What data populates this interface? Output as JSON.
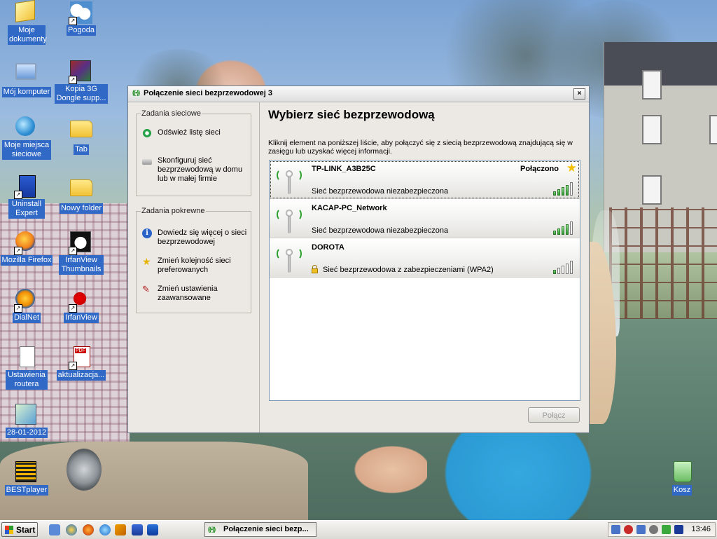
{
  "desktop": {
    "icons": [
      {
        "label": "Moje dokumenty",
        "glyph": "my-documents-icon"
      },
      {
        "label": "Pogoda",
        "glyph": "weather-icon"
      },
      {
        "label": "Mój komputer",
        "glyph": "my-computer-icon"
      },
      {
        "label": "Kopia 3G Dongle supp...",
        "glyph": "winrar-archive-icon"
      },
      {
        "label": "Moje miejsca sieciowe",
        "glyph": "network-places-icon"
      },
      {
        "label": "Tab",
        "glyph": "folder-icon"
      },
      {
        "label": "Uninstall Expert",
        "glyph": "uninstall-expert-icon"
      },
      {
        "label": "Nowy folder",
        "glyph": "folder-icon"
      },
      {
        "label": "Mozilla Firefox",
        "glyph": "firefox-icon"
      },
      {
        "label": "IrfanView Thumbnails",
        "glyph": "irfanview-thumbnails-icon"
      },
      {
        "label": "DialNet",
        "glyph": "dialnet-icon"
      },
      {
        "label": "IrfanView",
        "glyph": "irfanview-icon"
      },
      {
        "label": "Ustawienia routera",
        "glyph": "text-document-icon"
      },
      {
        "label": "aktualizacja...",
        "glyph": "pdf-document-icon"
      },
      {
        "label": "28-01-2012",
        "glyph": "calendar-icon"
      },
      {
        "label": "BESTplayer",
        "glyph": "media-player-icon"
      },
      {
        "label": "Kosz",
        "glyph": "recycle-bin-icon"
      }
    ]
  },
  "window": {
    "title": "Połączenie sieci bezprzewodowej 3",
    "close_label": "×",
    "network_tasks": {
      "title": "Zadania sieciowe",
      "items": [
        {
          "label": "Odśwież listę sieci",
          "icon": "refresh-icon"
        },
        {
          "label": "Skonfiguruj sieć bezprzewodową w domu lub w małej firmie",
          "icon": "configure-network-icon"
        }
      ]
    },
    "related_tasks": {
      "title": "Zadania pokrewne",
      "items": [
        {
          "label": "Dowiedz się więcej o sieci bezprzewodowej",
          "icon": "info-icon"
        },
        {
          "label": "Zmień kolejność sieci preferowanych",
          "icon": "star-icon"
        },
        {
          "label": "Zmień ustawienia zaawansowane",
          "icon": "tools-icon"
        }
      ]
    },
    "heading": "Wybierz sieć bezprzewodową",
    "instructions": "Kliknij element na poniższej liście, aby połączyć się z siecią bezprzewodową znajdującą się w zasięgu lub uzyskać więcej informacji.",
    "networks": [
      {
        "ssid": "TP-LINK_A3B25C",
        "security": "Sieć bezprzewodowa niezabezpieczona",
        "status": "Połączono",
        "secured": false,
        "signal": 4,
        "selected": true
      },
      {
        "ssid": "KACAP-PC_Network",
        "security": "Sieć bezprzewodowa niezabezpieczona",
        "status": "",
        "secured": false,
        "signal": 4,
        "selected": false
      },
      {
        "ssid": "DOROTA",
        "security": "Sieć bezprzewodowa z zabezpieczeniami (WPA2)",
        "status": "",
        "secured": true,
        "signal": 1,
        "selected": false
      }
    ],
    "connect_label": "Połącz"
  },
  "taskbar": {
    "start_label": "Start",
    "quick_launch": [
      "show-desktop-icon",
      "browser-icon",
      "firefox-icon",
      "internet-explorer-icon",
      "winamp-icon",
      "media-icon",
      "update-icon"
    ],
    "task_label": "Połączenie sieci bezp...",
    "clock": "13:46"
  },
  "colors": {
    "selection_blue": "#3169c6",
    "signal_green": "#2d9b2d"
  }
}
